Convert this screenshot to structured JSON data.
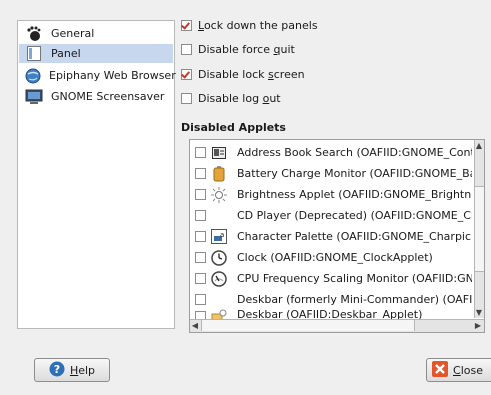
{
  "sidebar": {
    "items": [
      {
        "label": "General",
        "icon": "gnome-foot-icon",
        "selected": false
      },
      {
        "label": "Panel",
        "icon": "panel-icon",
        "selected": true
      },
      {
        "label": "Epiphany Web Browser",
        "icon": "epiphany-globe-icon",
        "selected": false
      },
      {
        "label": "GNOME Screensaver",
        "icon": "screensaver-monitor-icon",
        "selected": false
      }
    ]
  },
  "options": [
    {
      "pre": "",
      "mn": "L",
      "post": "ock down the panels",
      "checked": true
    },
    {
      "pre": "Disable force ",
      "mn": "q",
      "post": "uit",
      "checked": false
    },
    {
      "pre": "Disable lock ",
      "mn": "s",
      "post": "creen",
      "checked": true
    },
    {
      "pre": "Disable log ",
      "mn": "o",
      "post": "ut",
      "checked": false
    }
  ],
  "disabled_applets": {
    "title": "Disabled Applets",
    "rows": [
      {
        "label": "Address Book Search (OAFIID:GNOME_ContactL",
        "icon": "address-book-icon",
        "checked": false
      },
      {
        "label": "Battery Charge Monitor (OAFIID:GNOME_Battst",
        "icon": "battery-icon",
        "checked": false
      },
      {
        "label": "Brightness Applet (OAFIID:GNOME_BrightnessA",
        "icon": "brightness-icon",
        "checked": false
      },
      {
        "label": "CD Player (Deprecated) (OAFIID:GNOME_CDPla",
        "icon": "",
        "checked": false
      },
      {
        "label": "Character Palette (OAFIID:GNOME_CharpickerA",
        "icon": "character-palette-icon",
        "checked": false
      },
      {
        "label": "Clock (OAFIID:GNOME_ClockApplet)",
        "icon": "clock-icon",
        "checked": false
      },
      {
        "label": "CPU Frequency Scaling Monitor (OAFIID:GNOME",
        "icon": "cpu-frequency-icon",
        "checked": false
      },
      {
        "label": "Deskbar (formerly Mini-Commander) (OAFIID:G",
        "icon": "",
        "checked": false
      },
      {
        "label": "Deskbar (OAFIID:Deskbar_Applet)",
        "icon": "deskbar-icon",
        "checked": false
      }
    ]
  },
  "buttons": {
    "help": {
      "mn": "H",
      "post": "elp"
    },
    "close": {
      "mn": "C",
      "post": "lose"
    }
  }
}
